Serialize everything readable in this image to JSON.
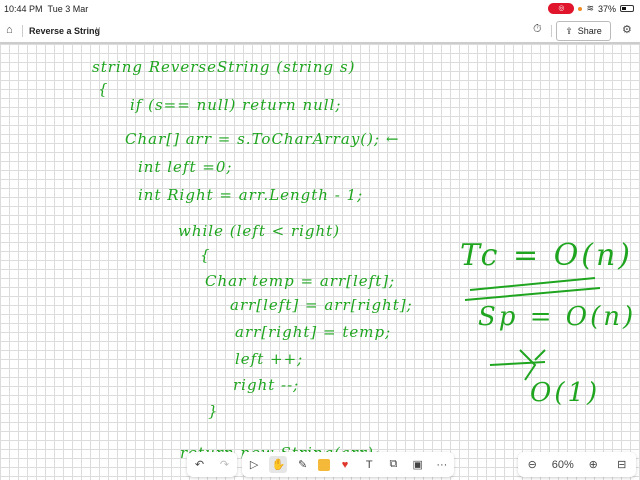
{
  "status_bar": {
    "time": "10:44 PM",
    "date": "Tue 3 Mar",
    "battery": "37%"
  },
  "header": {
    "title": "Reverse a String",
    "share_label": "Share"
  },
  "ink": {
    "code": [
      "string ReverseString (string s)",
      "{",
      "if (s== null) return null;",
      "Char[] arr = s.ToCharArray(); ←",
      "int left =0;",
      "int Right = arr.Length - 1;",
      "while (left < right)",
      "{",
      "Char temp = arr[left];",
      "arr[left] = arr[right];",
      "arr[right] = temp;",
      "left ++;",
      "right --;",
      "}",
      "return new String(arr);"
    ],
    "notes": [
      "Tc = O(n)",
      "Sp = O(n)",
      "O(1)"
    ]
  },
  "toolbar": {
    "zoom": "60%",
    "more": "···"
  },
  "colors": {
    "ink": "#1fa51f",
    "record": "#e0142b"
  }
}
